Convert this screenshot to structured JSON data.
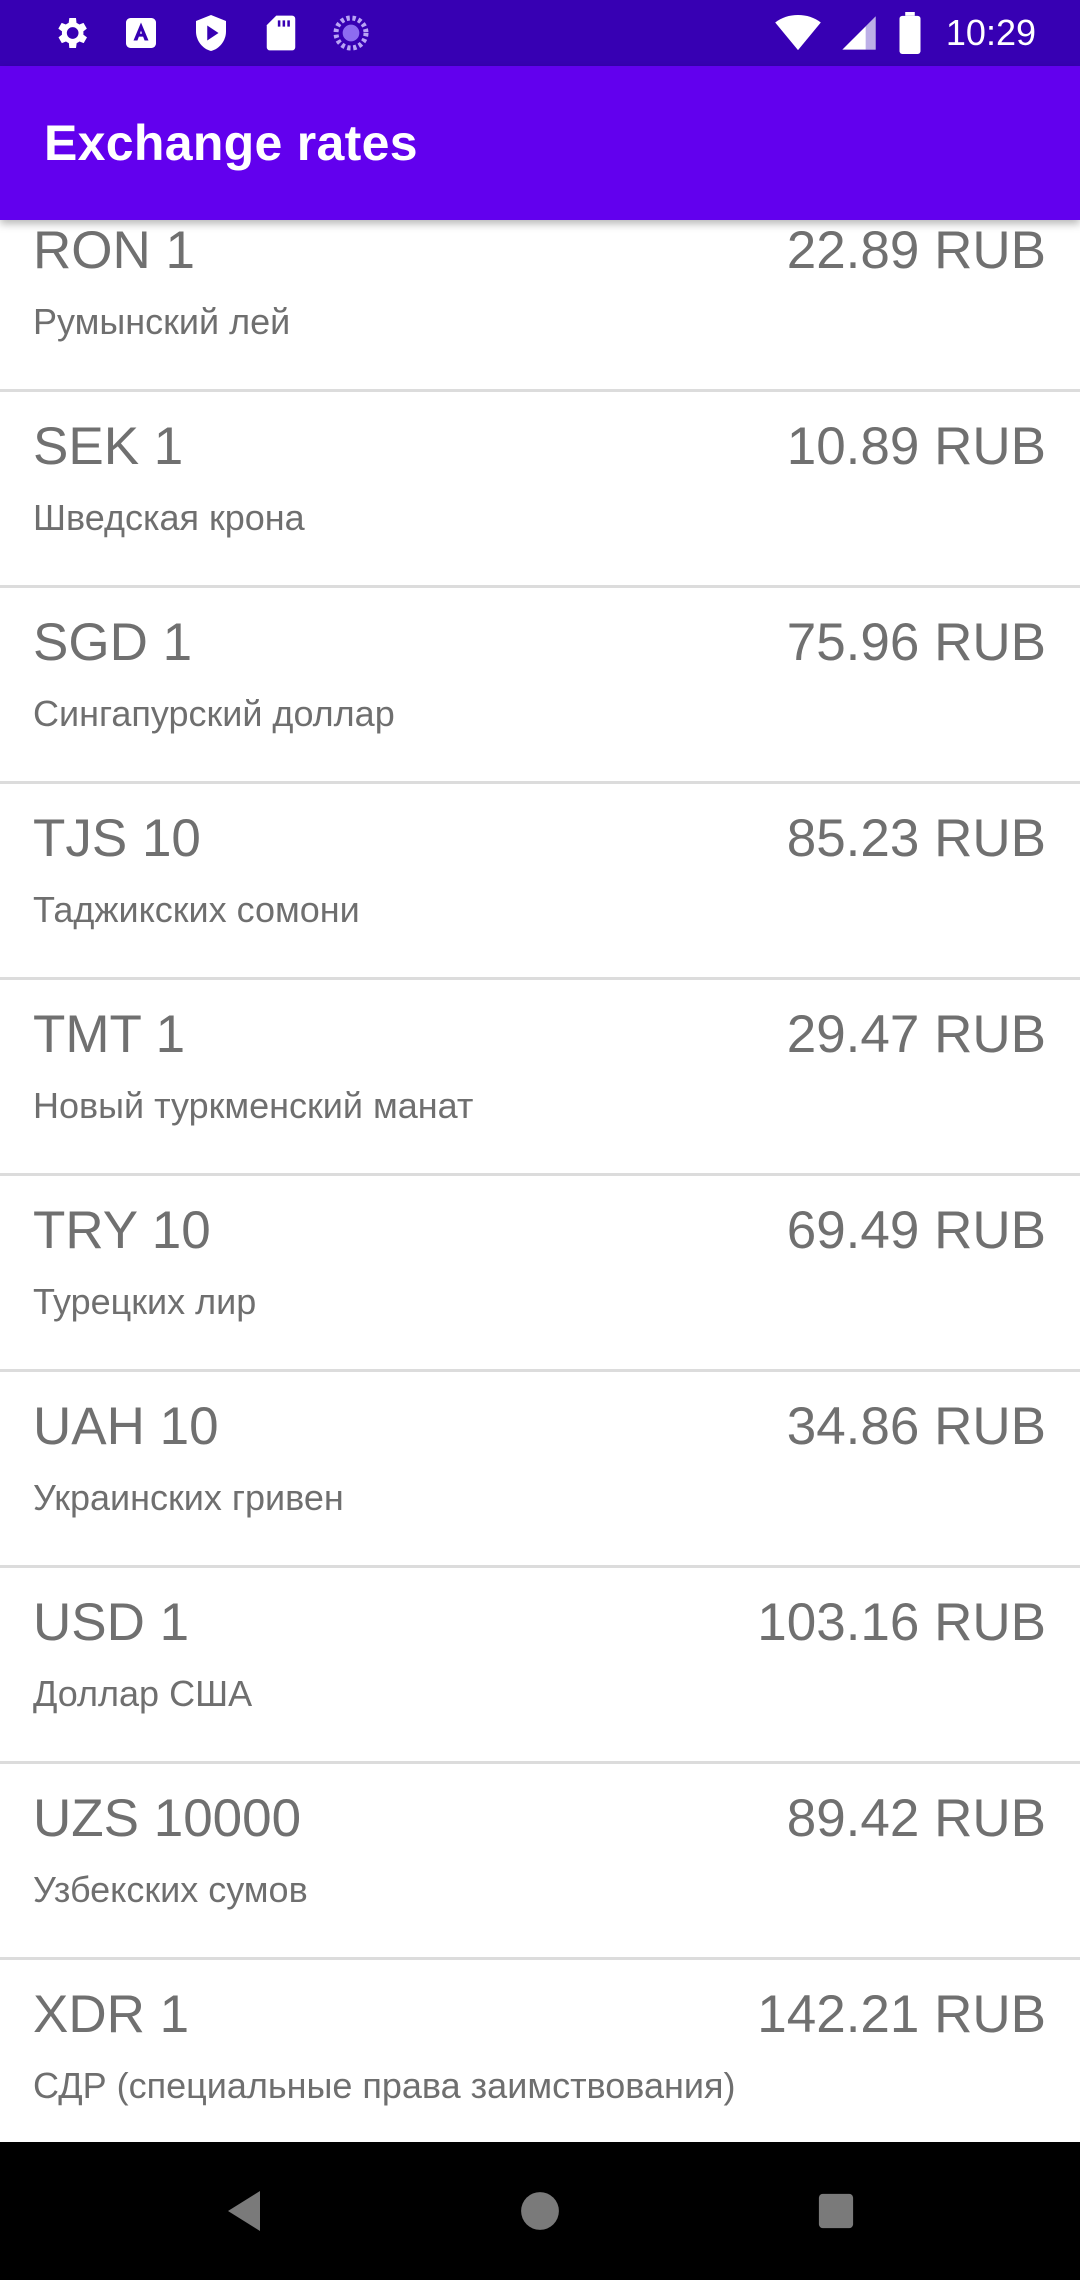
{
  "status_bar": {
    "time": "10:29",
    "left_icons": [
      "settings-icon",
      "a-badge-icon",
      "play-shield-icon",
      "sd-card-icon",
      "loading-icon"
    ],
    "right_icons": [
      "wifi-icon",
      "cell-signal-icon",
      "battery-icon"
    ]
  },
  "app_bar": {
    "title": "Exchange rates",
    "color": "#6200ee"
  },
  "rates": [
    {
      "code": "RON 1",
      "name": "Румынский лей",
      "rate": "22.89 RUB"
    },
    {
      "code": "SEK 1",
      "name": "Шведская крона",
      "rate": "10.89 RUB"
    },
    {
      "code": "SGD 1",
      "name": "Сингапурский доллар",
      "rate": "75.96 RUB"
    },
    {
      "code": "TJS 10",
      "name": "Таджикских сомони",
      "rate": "85.23 RUB"
    },
    {
      "code": "TMT 1",
      "name": "Новый туркменский манат",
      "rate": "29.47 RUB"
    },
    {
      "code": "TRY 10",
      "name": "Турецких лир",
      "rate": "69.49 RUB"
    },
    {
      "code": "UAH 10",
      "name": "Украинских гривен",
      "rate": "34.86 RUB"
    },
    {
      "code": "USD 1",
      "name": "Доллар США",
      "rate": "103.16 RUB"
    },
    {
      "code": "UZS 10000",
      "name": "Узбекских сумов",
      "rate": "89.42 RUB"
    },
    {
      "code": "XDR 1",
      "name": "СДР (специальные права заимствования)",
      "rate": "142.21 RUB"
    }
  ],
  "nav_bar": {
    "buttons": [
      "back-icon",
      "home-icon",
      "recents-icon"
    ]
  }
}
